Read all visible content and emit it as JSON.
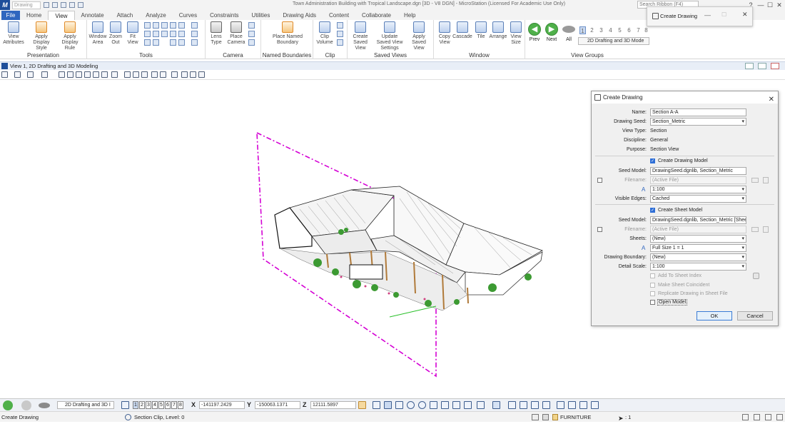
{
  "titlebar": {
    "quick_input": "Drawing",
    "title": "Town Administration Building with Tropical Landscape.dgn [3D - V8 DGN] - MicroStation (Licensed For Academic Use Only)",
    "search_placeholder": "Search Ribbon (F4)",
    "help": "?",
    "min": "—",
    "max": "☐",
    "close": "✕"
  },
  "file_tab": "File",
  "tabs": [
    "Home",
    "View",
    "Annotate",
    "Attach",
    "Analyze",
    "Curves",
    "Constraints",
    "Utilities",
    "Drawing Aids",
    "Content",
    "Collaborate",
    "Help"
  ],
  "active_tab": "View",
  "ribbon": {
    "presentation": {
      "label": "Presentation",
      "buttons": [
        "View Attributes",
        "Apply Display Style",
        "Apply Display Rule"
      ]
    },
    "tools": {
      "label": "Tools",
      "buttons": [
        "Window Area",
        "Zoom Out",
        "Fit View"
      ]
    },
    "camera": {
      "label": "Camera",
      "buttons": [
        "Lens Type",
        "Place Camera"
      ]
    },
    "named_boundaries": {
      "label": "Named Boundaries",
      "buttons": [
        "Place Named Boundary"
      ]
    },
    "clip": {
      "label": "Clip",
      "buttons": [
        "Clip Volume",
        "Clip Mask"
      ]
    },
    "saved_views": {
      "label": "Saved Views",
      "buttons": [
        "Create Saved View",
        "Update Saved View Settings",
        "Apply Saved View"
      ]
    },
    "window": {
      "label": "Window",
      "buttons": [
        "Copy View",
        "Cascade",
        "Tile",
        "Arrange",
        "View Size"
      ]
    },
    "view_groups": {
      "label": "View Groups",
      "buttons": [
        "Prev",
        "Next",
        "All"
      ],
      "numbers": [
        "1",
        "2",
        "3",
        "4",
        "5",
        "6",
        "7",
        "8"
      ],
      "dropdown": "2D Drafting and 3D Mode"
    }
  },
  "view_title": "View 1, 2D Drafting and 3D Modeling",
  "float_dialog": {
    "title": "Create Drawing"
  },
  "dialog": {
    "title": "Create Drawing",
    "name_label": "Name:",
    "name_value": "Section A-A",
    "seed_label": "Drawing Seed:",
    "seed_value": "Section_Metric",
    "viewtype_label": "View Type:",
    "viewtype_value": "Section",
    "discipline_label": "Discipline:",
    "discipline_value": "General",
    "purpose_label": "Purpose:",
    "purpose_value": "Section View",
    "create_drawing_model": "Create Drawing Model",
    "dm_seed_label": "Seed Model:",
    "dm_seed_value": "DrawingSeed.dgnlib, Section_Metric",
    "dm_filename_label": "Filename:",
    "dm_filename_value": "(Active File)",
    "dm_scale_value": "1:100",
    "visible_edges_label": "Visible Edges:",
    "visible_edges_value": "Cached",
    "create_sheet_model": "Create Sheet Model",
    "sm_seed_label": "Seed Model:",
    "sm_seed_value": "DrawingSeed.dgnlib, Section_Metric [Sheet]",
    "sm_filename_label": "Filename:",
    "sm_filename_value": "(Active File)",
    "sheets_label": "Sheets:",
    "sheets_value": "(New)",
    "sheet_scale_value": "Full Size 1 = 1",
    "boundary_label": "Drawing Boundary:",
    "boundary_value": "(New)",
    "detail_scale_label": "Detail Scale:",
    "detail_scale_value": "1:100",
    "add_to_sheet_index": "Add To Sheet Index",
    "make_sheet_coincident": "Make Sheet Coincident",
    "replicate_drawing": "Replicate Drawing in Sheet File",
    "open_model": "Open Model",
    "ok": "OK",
    "cancel": "Cancel"
  },
  "statusbar": {
    "view_group": "2D Drafting and 3D I",
    "view_numbers": [
      "1",
      "2",
      "3",
      "4",
      "5",
      "6",
      "7",
      "8"
    ],
    "x_label": "X",
    "x_value": "-141197.2429",
    "y_label": "Y",
    "y_value": "-150063.1371",
    "z_label": "Z",
    "z_value": "12111.5897",
    "prompt": "Create Drawing",
    "message": "Section Clip, Level: 0",
    "level": "FURNITURE",
    "selection": ": 1"
  },
  "colors": {
    "accent": "#2f66bf",
    "clip_plane": "#d400d4",
    "green_button": "#4fb04a"
  }
}
